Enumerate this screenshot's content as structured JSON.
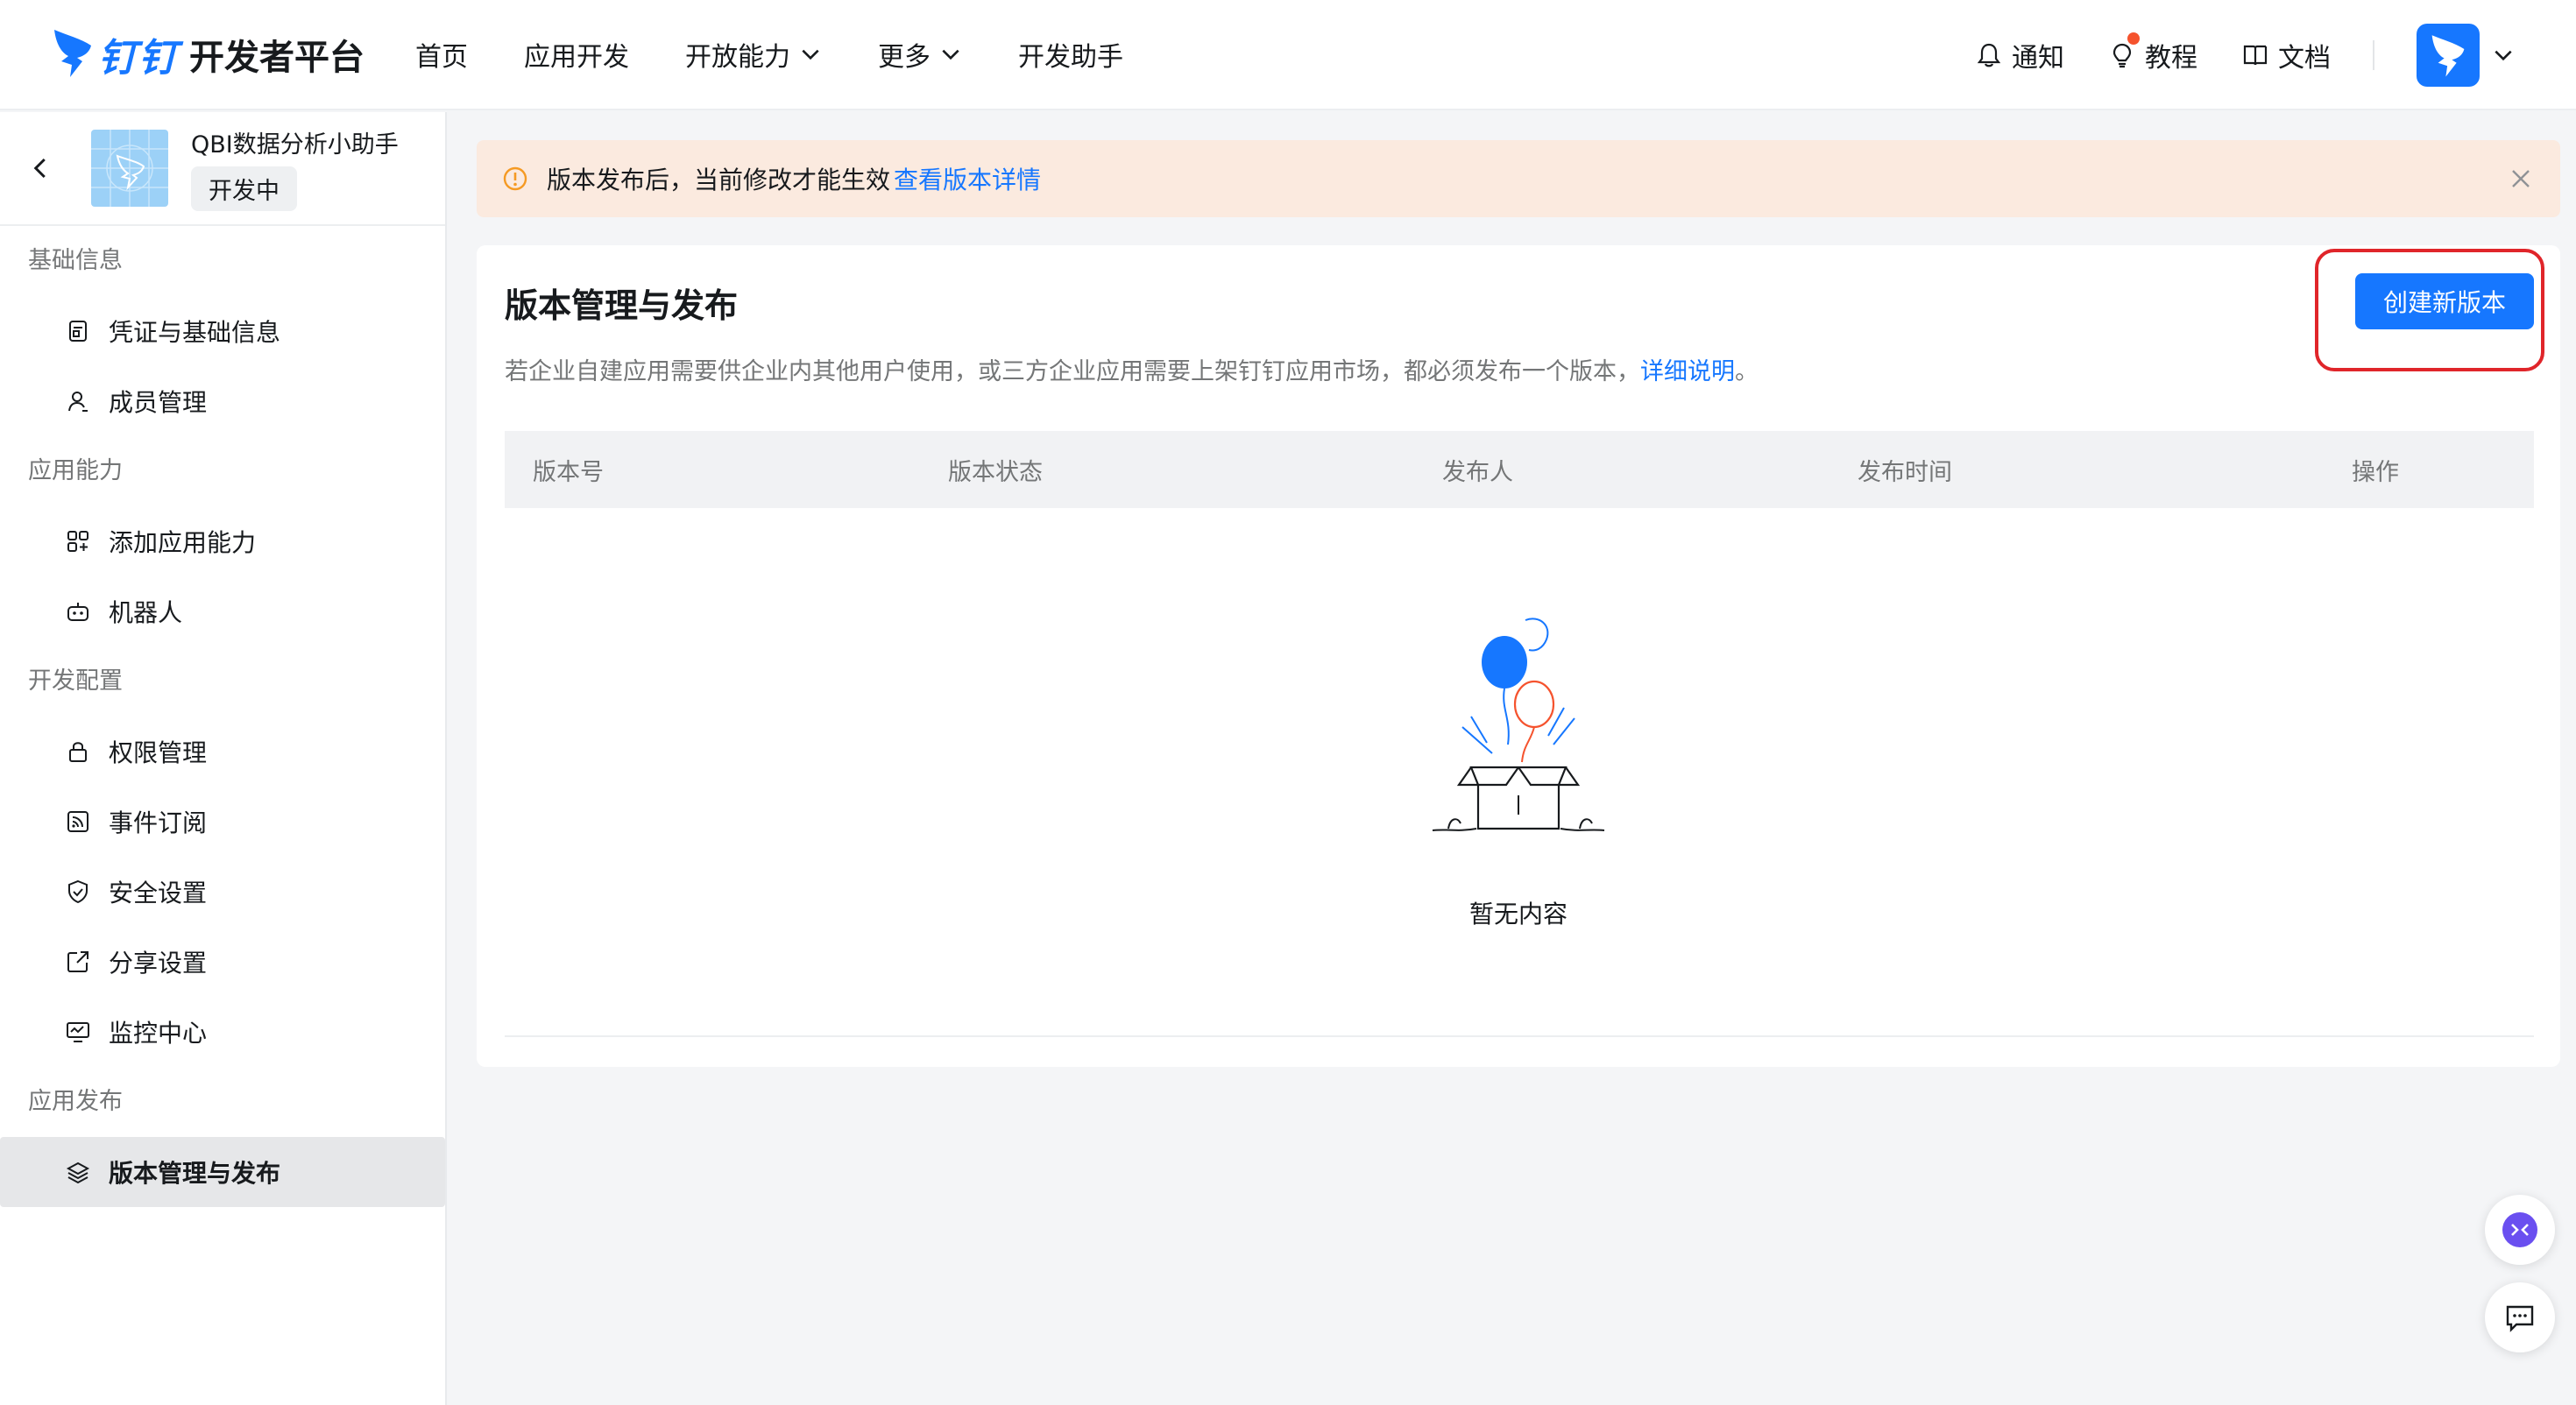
{
  "header": {
    "logo_brand": "钉钉",
    "logo_title": "开发者平台",
    "nav": [
      {
        "label": "首页"
      },
      {
        "label": "应用开发"
      },
      {
        "label": "开放能力"
      },
      {
        "label": "更多"
      },
      {
        "label": "开发助手"
      }
    ],
    "notify_label": "通知",
    "tutorial_label": "教程",
    "docs_label": "文档"
  },
  "sidebar": {
    "app_name": "QBI数据分析小助手",
    "app_status": "开发中",
    "groups": [
      {
        "title": "基础信息",
        "items": [
          {
            "label": "凭证与基础信息"
          },
          {
            "label": "成员管理"
          }
        ]
      },
      {
        "title": "应用能力",
        "items": [
          {
            "label": "添加应用能力"
          },
          {
            "label": "机器人"
          }
        ]
      },
      {
        "title": "开发配置",
        "items": [
          {
            "label": "权限管理"
          },
          {
            "label": "事件订阅"
          },
          {
            "label": "安全设置"
          },
          {
            "label": "分享设置"
          },
          {
            "label": "监控中心"
          }
        ]
      },
      {
        "title": "应用发布",
        "items": [
          {
            "label": "版本管理与发布"
          }
        ]
      }
    ]
  },
  "banner": {
    "text": "版本发布后，当前修改才能生效",
    "link": "查看版本详情"
  },
  "main": {
    "title": "版本管理与发布",
    "desc": "若企业自建应用需要供企业内其他用户使用，或三方企业应用需要上架钉钉应用市场，都必须发布一个版本，",
    "desc_link": "详细说明",
    "desc_end": "。",
    "create_label": "创建新版本",
    "columns": [
      "版本号",
      "版本状态",
      "发布人",
      "发布时间",
      "操作"
    ],
    "empty_text": "暂无内容"
  },
  "colors": {
    "accent": "#1677ff",
    "banner_bg": "#fbeadf",
    "highlight": "#e0252a"
  }
}
